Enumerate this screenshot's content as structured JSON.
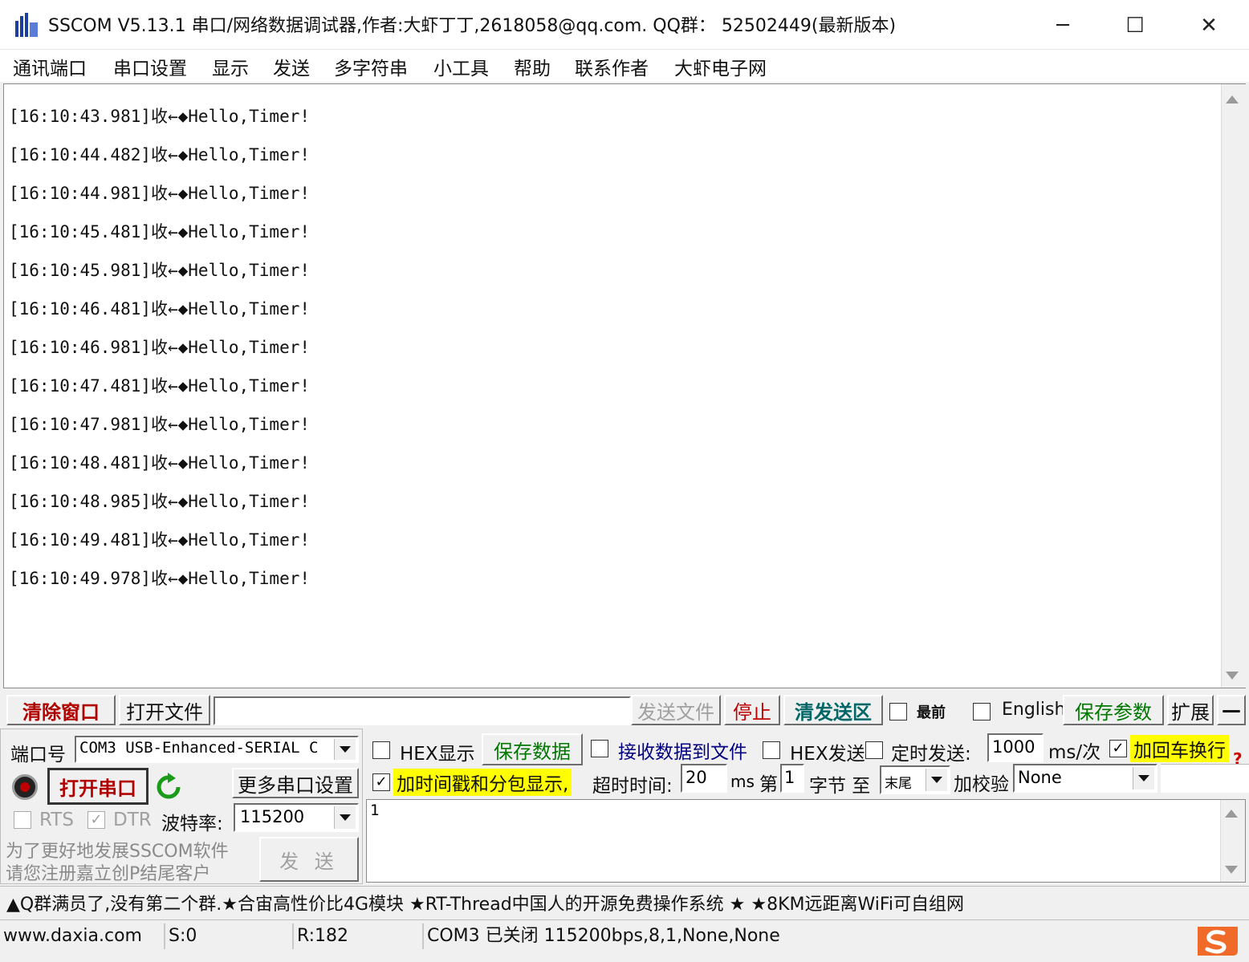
{
  "window": {
    "title": "SSCOM V5.13.1 串口/网络数据调试器,作者:大虾丁丁,2618058@qq.com. QQ群： 52502449(最新版本)",
    "minimize_glyph": "─",
    "maximize_glyph": "☐",
    "close_glyph": "✕"
  },
  "menu": [
    "通讯端口",
    "串口设置",
    "显示",
    "发送",
    "多字符串",
    "小工具",
    "帮助",
    "联系作者",
    "大虾电子网"
  ],
  "receive": {
    "lines": [
      "[16:10:43.981]收←◆Hello,Timer!",
      "[16:10:44.482]收←◆Hello,Timer!",
      "[16:10:44.981]收←◆Hello,Timer!",
      "[16:10:45.481]收←◆Hello,Timer!",
      "[16:10:45.981]收←◆Hello,Timer!",
      "[16:10:46.481]收←◆Hello,Timer!",
      "[16:10:46.981]收←◆Hello,Timer!",
      "[16:10:47.481]收←◆Hello,Timer!",
      "[16:10:47.981]收←◆Hello,Timer!",
      "[16:10:48.481]收←◆Hello,Timer!",
      "[16:10:48.985]收←◆Hello,Timer!",
      "[16:10:49.481]收←◆Hello,Timer!",
      "[16:10:49.978]收←◆Hello,Timer!"
    ]
  },
  "toolbar": {
    "clear_window": "清除窗口",
    "open_file": "打开文件",
    "file_path": "",
    "send_file": "发送文件",
    "stop": "停止",
    "clear_send": "清发送区",
    "topmost": "最前",
    "english": "English",
    "save_params": "保存参数",
    "expand": "扩展",
    "collapse": "—"
  },
  "port": {
    "port_label": "端口号",
    "port_value": "COM3 USB-Enhanced-SERIAL C",
    "open_button": "打开串口",
    "more_settings": "更多串口设置",
    "rts": "RTS",
    "dtr": "DTR",
    "rts_checked": false,
    "dtr_checked": true,
    "baud_label": "波特率:",
    "baud_value": "115200",
    "promo_line1": "为了更好地发展SSCOM软件",
    "promo_line2": "请您注册嘉立创P结尾客户",
    "send_button": "发 送"
  },
  "options": {
    "hex_display": "HEX显示",
    "save_data": "保存数据",
    "recv_to_file": "接收数据到文件",
    "hex_send": "HEX发送",
    "timed_send": "定时发送:",
    "interval_value": "1000",
    "interval_unit": "ms/次",
    "add_crlf": "加回车换行",
    "add_crlf_checked": true,
    "timestamp": "加时间戳和分包显示,",
    "timestamp_checked": true,
    "timeout_label": "超时时间:",
    "timeout_value": "20",
    "timeout_unit": "ms",
    "byte_prefix": "第",
    "byte_value": "1",
    "byte_label": "字节 至",
    "end_value": "末尾",
    "checksum_label": "加校验",
    "checksum_value": "None",
    "help_glyph": "?"
  },
  "send_area": {
    "text": "1"
  },
  "ticker": "▲Q群满员了,没有第二个群.★合宙高性价比4G模块 ★RT-Thread中国人的开源免费操作系统 ★ ★8KM远距离WiFi可自组网",
  "status": {
    "website": "www.daxia.com",
    "sent": "S:0",
    "received": "R:182",
    "port_state": "COM3 已关闭  115200bps,8,1,None,None"
  },
  "colors": {
    "clear_window_text": "#b00000",
    "green_text": "#007700",
    "clear_send_text": "#006666",
    "stop_text": "#c00000",
    "highlight": "#ffff00",
    "open_button_text": "#b00000",
    "recv_file_text": "#000080"
  }
}
